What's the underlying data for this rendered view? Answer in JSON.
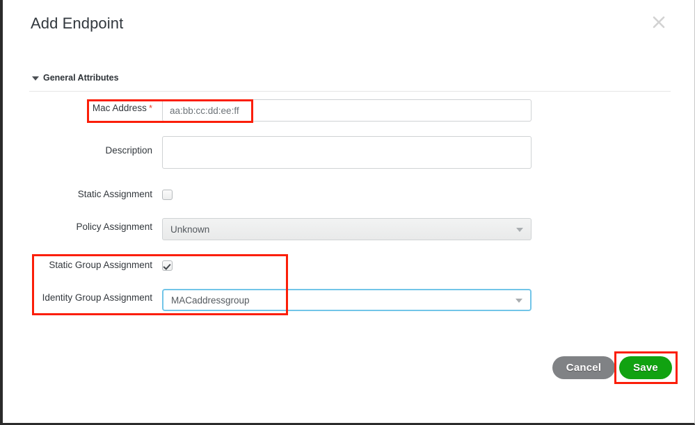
{
  "dialog": {
    "title": "Add Endpoint",
    "close_icon": "close-x-icon"
  },
  "section": {
    "caret_icon": "chevron-down-icon",
    "title": "General Attributes"
  },
  "fields": {
    "mac_address": {
      "label": "Mac Address",
      "required_marker": "*",
      "value": "aa:bb:cc:dd:ee:ff"
    },
    "description": {
      "label": "Description",
      "value": ""
    },
    "static_assignment": {
      "label": "Static Assignment",
      "checked": false
    },
    "policy_assignment": {
      "label": "Policy Assignment",
      "value": "Unknown",
      "disabled": true,
      "arrow_icon": "chevron-down-icon"
    },
    "static_group_assignment": {
      "label": "Static Group Assignment",
      "checked": true
    },
    "identity_group_assignment": {
      "label": "Identity Group Assignment",
      "value": "MACaddressgroup",
      "focused": true,
      "arrow_icon": "chevron-down-icon"
    }
  },
  "buttons": {
    "cancel": "Cancel",
    "save": "Save"
  },
  "colors": {
    "annotation": "#fb1e08",
    "save_green": "#11a211",
    "cancel_grey": "#808285",
    "required_red": "#e8402a",
    "focus_blue": "#72c5e8"
  }
}
